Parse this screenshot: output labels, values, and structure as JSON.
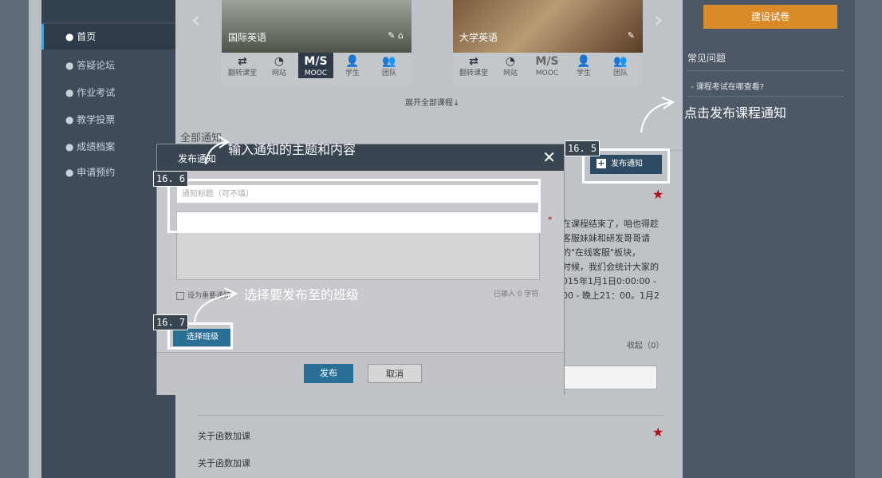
{
  "sidebar": {
    "items": [
      {
        "label": "● 首页"
      },
      {
        "label": "● 答疑论坛"
      },
      {
        "label": "● 作业考试"
      },
      {
        "label": "● 教学投票"
      },
      {
        "label": "● 成绩档案"
      },
      {
        "label": "● 申请预约"
      }
    ]
  },
  "courses": [
    {
      "title": "国际英语",
      "tools": [
        {
          "icon": "⇄",
          "label": "翻转课堂"
        },
        {
          "icon": "◔",
          "label": "网站"
        },
        {
          "icon": "M/S",
          "label": "MOOC"
        },
        {
          "icon": "👤",
          "label": "学生"
        },
        {
          "icon": "👥",
          "label": "团队"
        }
      ]
    },
    {
      "title": "大学英语",
      "tools": [
        {
          "icon": "⇄",
          "label": "翻转课堂"
        },
        {
          "icon": "◔",
          "label": "网站"
        },
        {
          "icon": "M/S",
          "label": "MOOC"
        },
        {
          "icon": "👤",
          "label": "学生"
        },
        {
          "icon": "👥",
          "label": "团队"
        }
      ]
    }
  ],
  "expand_all": "展开全部课程↓",
  "tabs_text": "全部通知",
  "right_panel": {
    "build_button": "建设试卷",
    "faq_title": "常见问题",
    "faq_items": [
      "- 课程考试在哪查看?"
    ]
  },
  "publish_notice_button": "发布通知",
  "background_post": {
    "lines": [
      "在课程结束了，咱也得趁",
      "客服妹妹和研发哥哥请",
      "的\"在线客服\"板块，",
      "时候，我们会统计大家的",
      "015年1月1日0:00:00 -",
      "00 - 晚上21：00。1月2"
    ],
    "collapse": "收起（0）",
    "post_title_1": "关于函数加课",
    "post_title_2": "关于函数加课"
  },
  "modal": {
    "title": "发布通知",
    "close": "✕",
    "title_placeholder": "通知标题（可不填）",
    "required_mark": "*",
    "important_label": "设为重要通知",
    "char_count": "已输入 0 字符",
    "select_class": "选择班级",
    "publish": "发布",
    "cancel": "取消"
  },
  "annotations": {
    "step_165": "16. 5",
    "step_166": "16. 6",
    "step_167": "16. 7",
    "text_165": "点击发布课程通知",
    "text_166": "输入通知的主题和内容",
    "text_167": "选择要发布至的班级"
  },
  "colors": {
    "accent_blue": "#2a6f96",
    "orange": "#d98b2a",
    "star_red": "#b01010",
    "modal_header": "#3a4552"
  }
}
